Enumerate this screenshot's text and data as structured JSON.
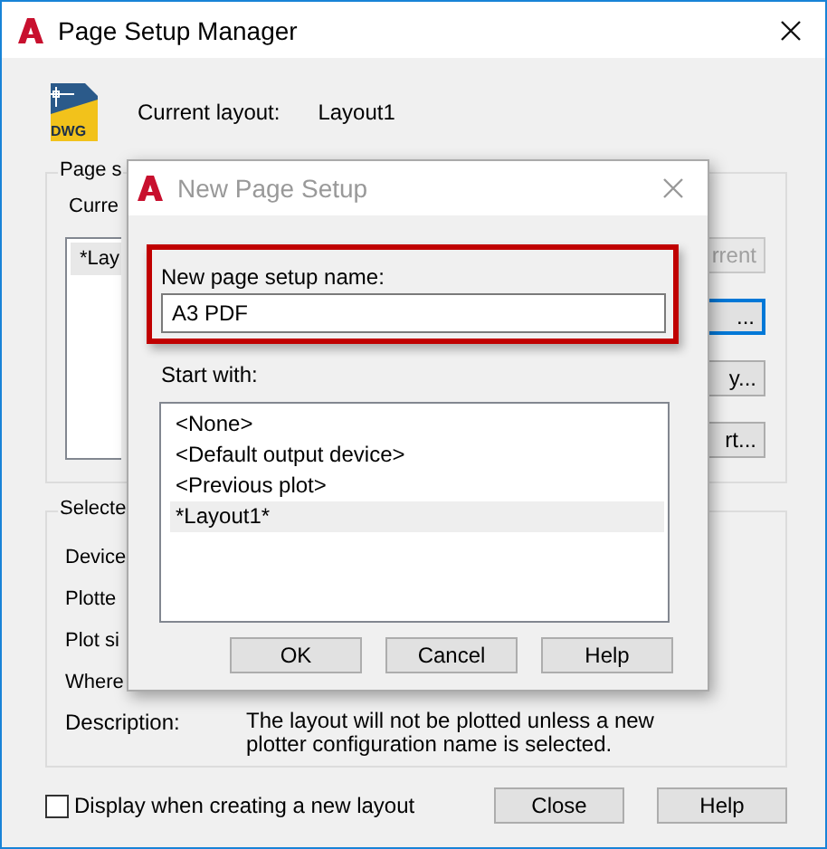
{
  "window": {
    "title": "Page Setup Manager",
    "active": true
  },
  "file_icon": {
    "label": "DWG"
  },
  "current_layout": {
    "label": "Current layout:",
    "value": "Layout1"
  },
  "page_setups_group": {
    "legend": "Page s",
    "current_label": "Curre",
    "list": [
      {
        "text": "*Lay",
        "selected": true
      }
    ],
    "buttons": [
      {
        "label": "rrent",
        "disabled": true,
        "focused": false
      },
      {
        "label": "...",
        "disabled": false,
        "focused": true
      },
      {
        "label": "y...",
        "disabled": false,
        "focused": false
      },
      {
        "label": "rt...",
        "disabled": false,
        "focused": false
      }
    ]
  },
  "details_group": {
    "legend": "Selecte",
    "labels": [
      "Device",
      "Plotte",
      "Plot si",
      "Where"
    ],
    "description": {
      "label": "Description:",
      "text": "The layout will not be plotted unless a new plotter configuration name is selected."
    }
  },
  "display_checkbox": {
    "label": "Display when creating a new layout",
    "checked": false
  },
  "buttons": [
    "Close",
    "Help"
  ],
  "dialog": {
    "title": "New Page Setup",
    "active": false,
    "name_field": {
      "label": "New page setup name:",
      "value": "A3 PDF",
      "highlighted": true
    },
    "start_with": {
      "label": "Start with:",
      "items": [
        {
          "text": "<None>",
          "selected": false
        },
        {
          "text": "<Default output device>",
          "selected": false
        },
        {
          "text": "<Previous plot>",
          "selected": false
        },
        {
          "text": "*Layout1*",
          "selected": true
        }
      ]
    },
    "buttons": [
      "OK",
      "Cancel",
      "Help"
    ]
  }
}
